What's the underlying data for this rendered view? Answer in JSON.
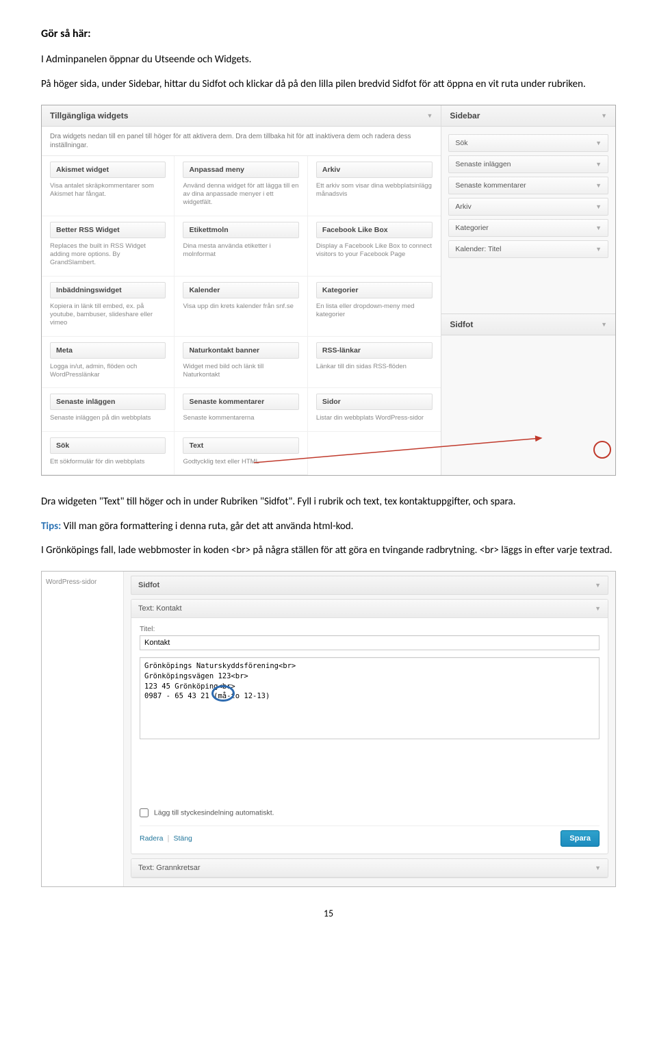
{
  "doc": {
    "heading": "Gör så här:",
    "p1": "I Adminpanelen öppnar du Utseende och Widgets.",
    "p2": "På höger sida, under Sidebar, hittar du Sidfot och klickar då på den lilla pilen bredvid Sidfot för att öppna en vit ruta under rubriken.",
    "p3": "Dra widgeten \"Text\" till höger och in under Rubriken \"Sidfot\". Fyll i rubrik och text, tex kontaktuppgifter, och spara.",
    "p4_label": "Tips:",
    "p4_rest": " Vill man göra formattering i denna ruta, går det att använda html-kod.",
    "p5": "I Grönköpings fall, lade webbmoster in koden <br> på några ställen för att göra en tvingande radbrytning. <br> läggs in efter varje textrad.",
    "page_num": "15"
  },
  "shot1": {
    "title": "Tillgängliga widgets",
    "note": "Dra widgets nedan till en panel till höger för att aktivera dem. Dra dem tillbaka hit för att inaktivera dem och radera dess inställningar.",
    "widgets": [
      {
        "t": "Akismet widget",
        "d": "Visa antalet skräpkommentarer som Akismet har fångat."
      },
      {
        "t": "Anpassad meny",
        "d": "Använd denna widget för att lägga till en av dina anpassade menyer i ett widgetfält."
      },
      {
        "t": "Arkiv",
        "d": "Ett arkiv som visar dina webbplatsinlägg månadsvis"
      },
      {
        "t": "Better RSS Widget",
        "d": "Replaces the built in RSS Widget adding more options. By GrandSlambert."
      },
      {
        "t": "Etikettmoln",
        "d": "Dina mesta använda etiketter i molnformat"
      },
      {
        "t": "Facebook Like Box",
        "d": "Display a Facebook Like Box to connect visitors to your Facebook Page"
      },
      {
        "t": "Inbäddningswidget",
        "d": "Kopiera in länk till embed, ex. på youtube, bambuser, slideshare eller vimeo"
      },
      {
        "t": "Kalender",
        "d": "Visa upp din krets kalender från snf.se"
      },
      {
        "t": "Kategorier",
        "d": "En lista eller dropdown-meny med kategorier"
      },
      {
        "t": "Meta",
        "d": "Logga in/ut, admin, flöden och WordPresslänkar"
      },
      {
        "t": "Naturkontakt banner",
        "d": "Widget med bild och länk till Naturkontakt"
      },
      {
        "t": "RSS-länkar",
        "d": "Länkar till din sidas RSS-flöden"
      },
      {
        "t": "Senaste inläggen",
        "d": "Senaste inläggen på din webbplats"
      },
      {
        "t": "Senaste kommentarer",
        "d": "Senaste kommentarerna"
      },
      {
        "t": "Sidor",
        "d": "Listar din webbplats WordPress-sidor"
      },
      {
        "t": "Sök",
        "d": "Ett sökformulär för din webbplats"
      },
      {
        "t": "Text",
        "d": "Godtycklig text eller HTML"
      }
    ],
    "sidebar_title": "Sidebar",
    "sidebar_items": [
      "Sök",
      "Senaste inläggen",
      "Senaste kommentarer",
      "Arkiv",
      "Kategorier",
      "Kalender: Titel"
    ],
    "sidfot_title": "Sidfot"
  },
  "shot2": {
    "left_text": "WordPress-sidor",
    "sidfot": "Sidfot",
    "text_kontakt": "Text: Kontakt",
    "titel_label": "Titel:",
    "titel_value": "Kontakt",
    "textarea_value": "Grönköpings Naturskyddsförening<br>\nGrönköpingsvägen 123<br>\n123 45 Grönköping<br>\n0987 - 65 43 21 (må-to 12-13)",
    "checkbox_label": "Lägg till styckesindelning automatiskt.",
    "radera": "Radera",
    "stang": "Stäng",
    "spara": "Spara",
    "grannkretsar": "Text: Grannkretsar"
  }
}
